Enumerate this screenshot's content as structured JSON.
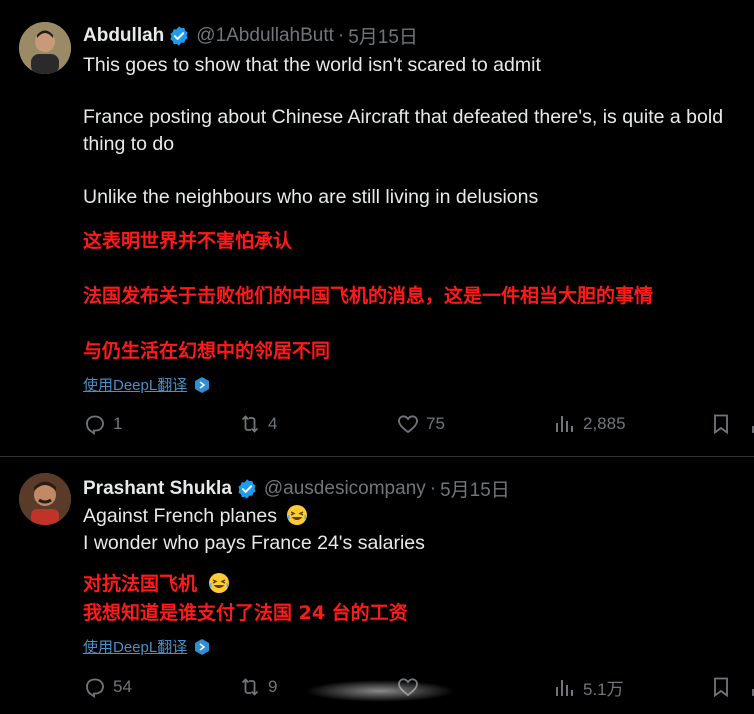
{
  "tweets": [
    {
      "name": "Abdullah",
      "handle": "@1AbdullahButt",
      "dot": "·",
      "date": "5月15日",
      "lines": [
        "This goes to show that the world isn't scared to admit",
        "France posting about Chinese Aircraft that defeated there's, is quite a bold",
        "thing to do",
        "Unlike the neighbours who are still living in delusions"
      ],
      "zh_lines": [
        "这表明世界并不害怕承认",
        "法国发布关于击败他们的中国飞机的消息，这是一件相当大胆的事情",
        "与仍生活在幻想中的邻居不同"
      ],
      "deepl_label": "使用DeepL翻译",
      "replies": "1",
      "retweets": "4",
      "likes": "75",
      "views": "2,885"
    },
    {
      "name": "Prashant Shukla",
      "handle": "@ausdesicompany",
      "dot": "·",
      "date": "5月15日",
      "lines": [
        "Against French planes",
        "I wonder who pays France 24's salaries"
      ],
      "zh_lines": [
        "对抗法国飞机",
        "我想知道是谁支付了法国 24 台的工资"
      ],
      "deepl_label": "使用DeepL翻译",
      "replies": "54",
      "retweets": "9",
      "likes": "",
      "views": "5.1万"
    }
  ],
  "colors": {
    "background": "#000000",
    "text": "#e7e9ea",
    "muted": "#71767b",
    "verified": "#1d9bf0",
    "translation_red": "#ff1a1a",
    "link": "#4a90c8"
  },
  "icons": [
    "verified-badge-icon",
    "reply-icon",
    "retweet-icon",
    "like-icon",
    "views-icon",
    "bookmark-icon",
    "deepl-icon",
    "laughing-emoji-icon"
  ]
}
